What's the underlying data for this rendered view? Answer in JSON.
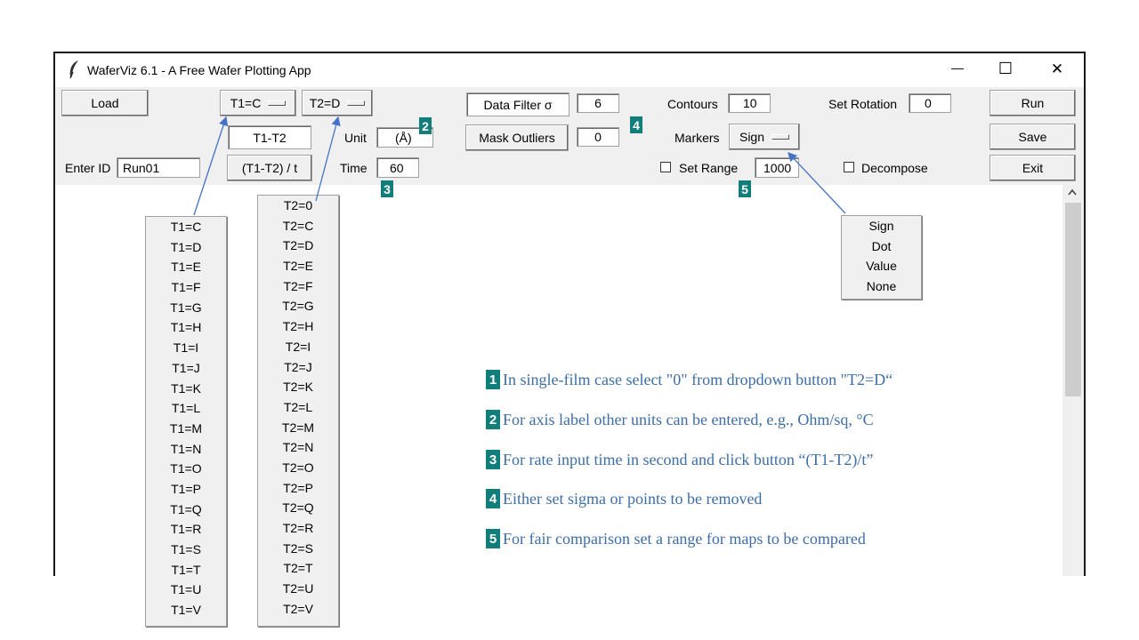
{
  "window": {
    "title": "WaferViz 6.1 - A Free Wafer Plotting App",
    "controls": {
      "minimize": "—",
      "maximize": "☐",
      "close": "✕"
    }
  },
  "toolbar": {
    "load": "Load",
    "t1_menu": "T1=C",
    "t2_menu": "T2=D",
    "t1_minus_t2": "T1-T2",
    "rate_button": "(T1-T2) / t",
    "unit_label": "Unit",
    "unit_value": "(Å)",
    "time_label": "Time",
    "time_value": "60",
    "enter_id_label": "Enter ID",
    "enter_id_value": "Run01",
    "data_filter": "Data Filter σ",
    "data_filter_value": "6",
    "mask_outliers": "Mask Outliers",
    "mask_outliers_value": "0",
    "contours_label": "Contours",
    "contours_value": "10",
    "markers_label": "Markers",
    "markers_menu": "Sign",
    "set_range_label": "Set Range",
    "set_range_value": "1000",
    "set_rotation_label": "Set Rotation",
    "set_rotation_value": "0",
    "decompose_label": "Decompose",
    "run": "Run",
    "save": "Save",
    "exit": "Exit"
  },
  "badges": [
    "1",
    "2",
    "3",
    "4",
    "5"
  ],
  "t1_options": [
    "T1=C",
    "T1=D",
    "T1=E",
    "T1=F",
    "T1=G",
    "T1=H",
    "T1=I",
    "T1=J",
    "T1=K",
    "T1=L",
    "T1=M",
    "T1=N",
    "T1=O",
    "T1=P",
    "T1=Q",
    "T1=R",
    "T1=S",
    "T1=T",
    "T1=U",
    "T1=V"
  ],
  "t2_options": [
    "T2=0",
    "T2=C",
    "T2=D",
    "T2=E",
    "T2=F",
    "T2=G",
    "T2=H",
    "T2=I",
    "T2=J",
    "T2=K",
    "T2=L",
    "T2=M",
    "T2=N",
    "T2=O",
    "T2=P",
    "T2=Q",
    "T2=R",
    "T2=S",
    "T2=T",
    "T2=U",
    "T2=V"
  ],
  "marker_options": [
    "Sign",
    "Dot",
    "Value",
    "None"
  ],
  "notes": [
    {
      "num": "1",
      "text": "In single-film case select \"0\" from dropdown button \"T2=D“"
    },
    {
      "num": "2",
      "text": "For axis label other units can be entered, e.g., Ohm/sq, °C"
    },
    {
      "num": "3",
      "text": "For rate input time in second and click button “(T1-T2)/t”"
    },
    {
      "num": "4",
      "text": "Either set sigma or points to be removed"
    },
    {
      "num": "5",
      "text": "For fair comparison set a range for maps to be compared"
    }
  ],
  "colors": {
    "badge": "#127e7b",
    "note_text": "#3e6ea6",
    "arrow": "#4472c4"
  },
  "icons": {
    "app": "feather-icon",
    "scroll_up": "chevron-up-icon"
  }
}
